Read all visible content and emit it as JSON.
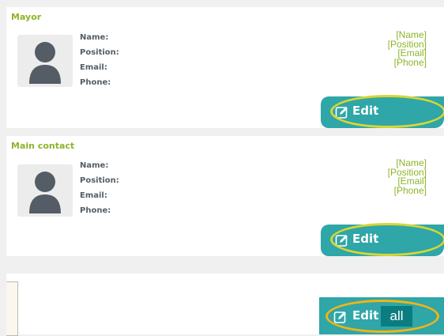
{
  "cards": [
    {
      "title": "Mayor",
      "labels": {
        "name": "Name:",
        "position": "Position:",
        "email": "Email:",
        "phone": "Phone:"
      },
      "values": {
        "name": "[Name]",
        "position": "[Position]",
        "email": "[Email]",
        "phone": "[Phone]"
      },
      "edit_label": "Edit"
    },
    {
      "title": "Main contact",
      "labels": {
        "name": "Name:",
        "position": "Position:",
        "email": "Email:",
        "phone": "Phone:"
      },
      "values": {
        "name": "[Name]",
        "position": "[Position]",
        "email": "[Email]",
        "phone": "[Phone]"
      },
      "edit_label": "Edit"
    }
  ],
  "edit_all": {
    "edit_label": "Edit",
    "all_label": "all"
  },
  "colors": {
    "accent": "#8db52a",
    "button": "#2fa6a8",
    "button_dark": "#0b7d80",
    "highlight": "#d7d635",
    "highlight_orange": "#f1b415"
  }
}
